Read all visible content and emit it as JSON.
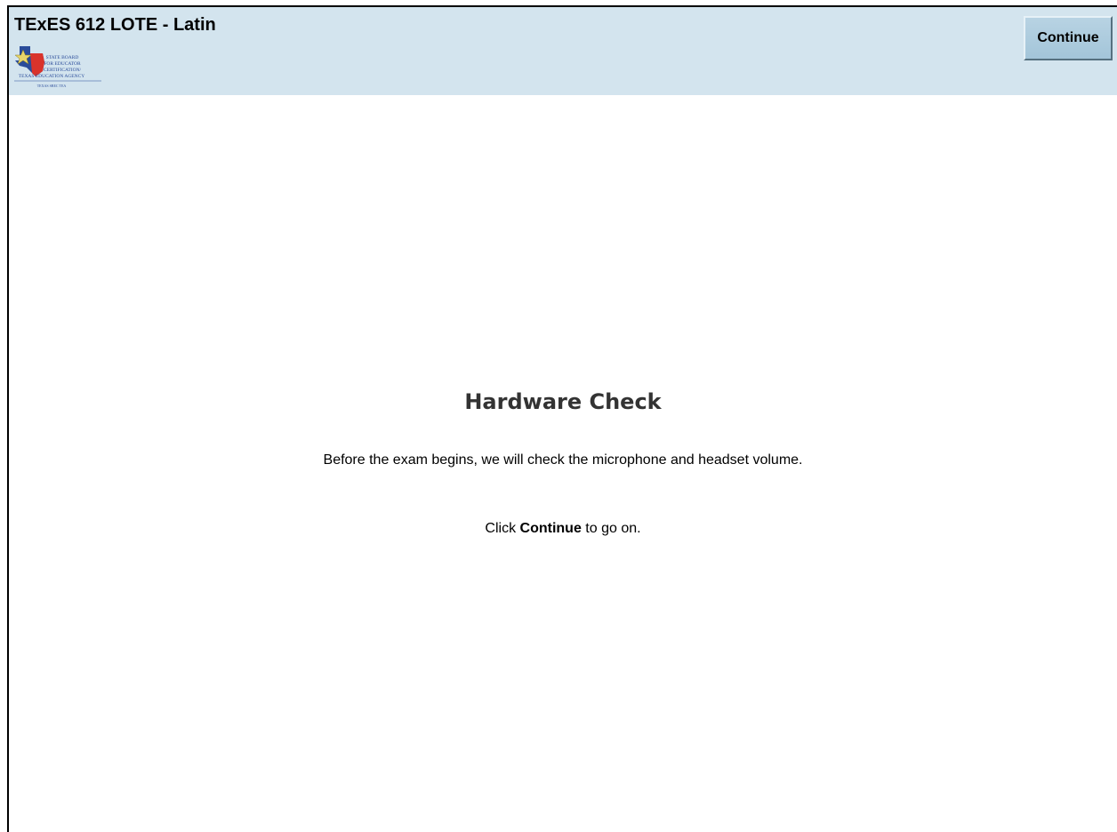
{
  "header": {
    "title": "TExES 612 LOTE - Latin",
    "logo": {
      "line1": "STATE BOARD",
      "line2": "FOR EDUCATOR",
      "line3": "CERTIFICATION/",
      "line4": "TEXAS EDUCATION AGENCY",
      "tagline": "TEXAS SBEC TEA"
    },
    "continue_label": "Continue"
  },
  "main": {
    "heading": "Hardware Check",
    "description": "Before the exam begins, we will check the microphone and headset volume.",
    "instruction": {
      "prefix": "Click ",
      "emphasis": "Continue",
      "suffix": " to go on."
    }
  },
  "colors": {
    "header_bg": "#d3e4ee",
    "button_bg": "#a9c9dc",
    "heading_text": "#333333"
  }
}
